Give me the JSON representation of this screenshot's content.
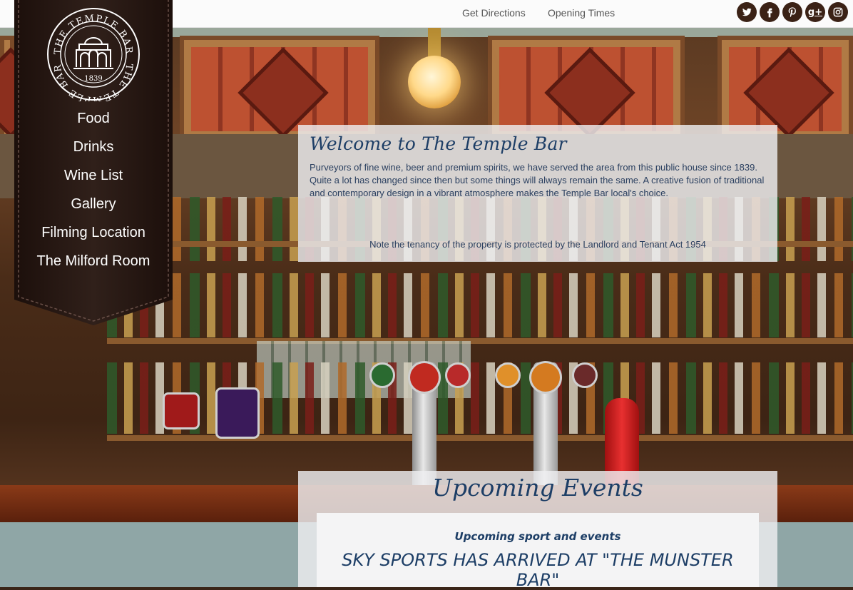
{
  "topnav": {
    "links": [
      "Get Directions",
      "Opening Times"
    ],
    "social": [
      {
        "name": "twitter",
        "glyph": "t"
      },
      {
        "name": "facebook",
        "glyph": "f"
      },
      {
        "name": "pinterest",
        "glyph": "p"
      },
      {
        "name": "google-plus",
        "glyph": "g+"
      },
      {
        "name": "instagram",
        "glyph": ""
      }
    ]
  },
  "logo": {
    "ring_text": "THE TEMPLE BAR",
    "year": "1839"
  },
  "sidebar": {
    "items": [
      {
        "label": "Food"
      },
      {
        "label": "Drinks"
      },
      {
        "label": "Wine List"
      },
      {
        "label": "Gallery"
      },
      {
        "label": "Filming Location"
      },
      {
        "label": "The Milford Room"
      }
    ]
  },
  "welcome": {
    "title": "Welcome to The Temple Bar",
    "body": "Purveyors of fine wine, beer and premium spirits, we have served the area from this public house since 1839. Quite a lot has changed since then but some things will always remain the same. A creative fusion of traditional and contemporary design in a vibrant atmosphere makes the Temple Bar local's choice.",
    "note": "Note the tenancy of the property is protected by the Landlord and Tenant Act 1954"
  },
  "events": {
    "title": "Upcoming Events",
    "subtitle": "Upcoming sport and events",
    "headline": "SKY SPORTS HAS ARRIVED AT \"THE MUNSTER BAR\""
  },
  "colors": {
    "heading_blue": "#1d3e66",
    "banner_leather": "#2a1712",
    "social_bg": "#3b2216"
  }
}
